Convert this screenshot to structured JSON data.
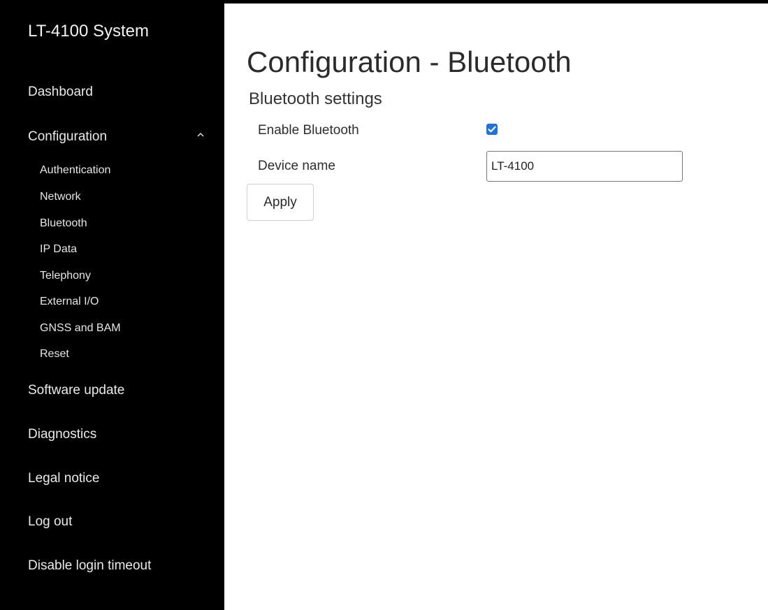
{
  "sidebar": {
    "brand": "LT-4100 System",
    "items": {
      "dashboard": "Dashboard",
      "configuration": "Configuration",
      "software_update": "Software update",
      "diagnostics": "Diagnostics",
      "legal_notice": "Legal notice",
      "log_out": "Log out",
      "disable_login_timeout": "Disable login timeout"
    },
    "configuration_subitems": {
      "authentication": "Authentication",
      "network": "Network",
      "bluetooth": "Bluetooth",
      "ip_data": "IP Data",
      "telephony": "Telephony",
      "external_io": "External I/O",
      "gnss_and_bam": "GNSS and BAM",
      "reset": "Reset"
    },
    "configuration_expanded_icon": "chevron-up-icon"
  },
  "main": {
    "page_title": "Configuration - Bluetooth",
    "section_title": "Bluetooth settings",
    "enable_bluetooth_label": "Enable Bluetooth",
    "enable_bluetooth_checked": true,
    "device_name_label": "Device name",
    "device_name_value": "LT-4100",
    "apply_label": "Apply"
  },
  "colors": {
    "sidebar_background": "#000000",
    "sidebar_text": "#ffffff",
    "checkbox_accent": "#1a73e8"
  }
}
